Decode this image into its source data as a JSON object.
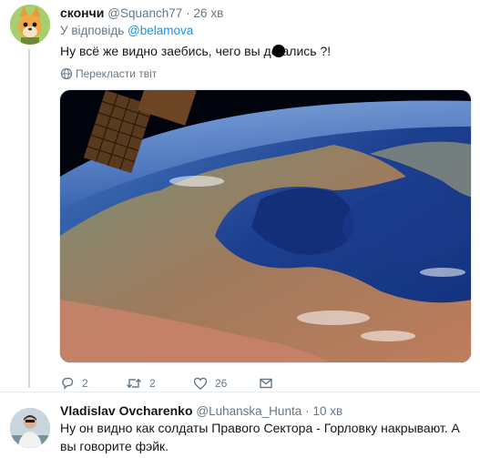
{
  "tweet1": {
    "name": "скончи",
    "handle": "@Squanch77",
    "separator": "·",
    "time": "26 хв",
    "reply_prefix": "У відповідь",
    "reply_to": "@belamova",
    "text_before": "Ну всё же видно заебись, чего вы до",
    "text_after": "ались ?!",
    "translate_label": "Перекласти твіт",
    "image_description": "earth-from-space-photo",
    "replies": "2",
    "retweets": "2",
    "likes": "26"
  },
  "tweet2": {
    "name": "Vladislav Ovcharenko",
    "handle": "@Luhanska_Hunta",
    "separator": "·",
    "time": "10 хв",
    "text": "Ну он видно как солдаты Правого Сектора - Горловку накрывают. А вы говорите фэйк."
  },
  "colors": {
    "link": "#1b95e0",
    "secondary_text": "#657786",
    "primary_text": "#14171a",
    "thread_line": "#ccd6dd"
  },
  "icons": [
    "reply-icon",
    "retweet-icon",
    "like-icon",
    "direct-message-icon",
    "globe-icon"
  ]
}
